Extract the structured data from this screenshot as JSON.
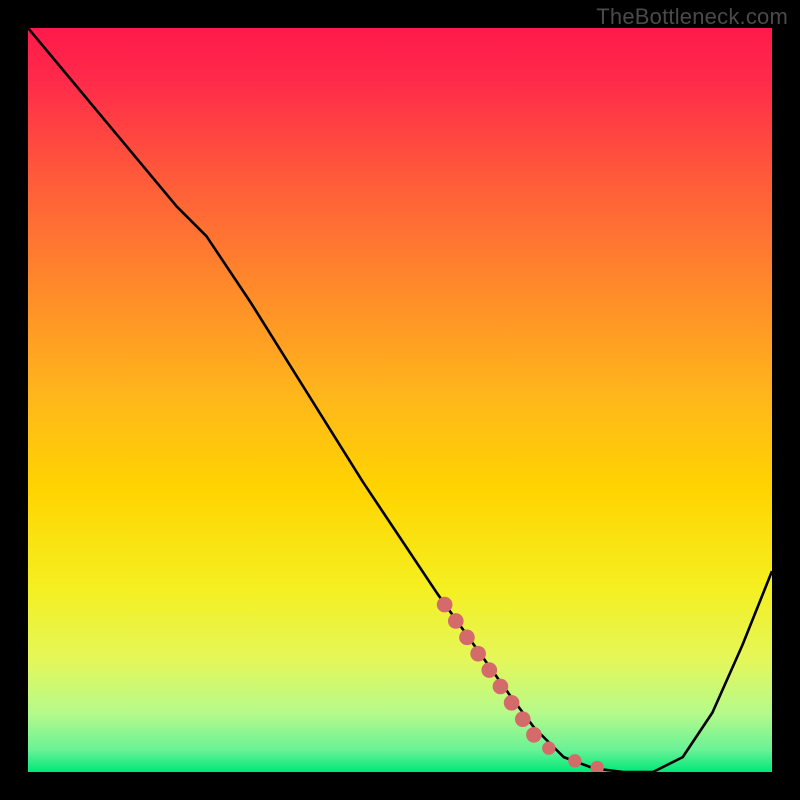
{
  "watermark": "TheBottleneck.com",
  "colors": {
    "frame": "#000000",
    "gradient_top": "#ff1a4b",
    "gradient_mid": "#ffd400",
    "gradient_bottom": "#00e878",
    "curve": "#000000",
    "marker": "#d46a6a"
  },
  "chart_data": {
    "type": "line",
    "title": "",
    "xlabel": "",
    "ylabel": "",
    "xlim": [
      0,
      100
    ],
    "ylim": [
      0,
      100
    ],
    "x": [
      0,
      5,
      10,
      15,
      20,
      24,
      30,
      35,
      40,
      45,
      50,
      55,
      60,
      65,
      68,
      72,
      76,
      80,
      84,
      88,
      92,
      96,
      100
    ],
    "y": [
      100,
      94,
      88,
      82,
      76,
      72,
      63,
      55,
      47,
      39,
      31.5,
      24,
      17,
      10,
      6,
      2,
      0.5,
      0,
      0,
      2,
      8,
      17,
      27
    ],
    "highlight_segment": {
      "x": [
        56,
        57.5,
        59,
        60.5,
        62,
        63.5,
        65,
        66.5,
        68
      ],
      "y": [
        22.5,
        20.3,
        18.1,
        15.9,
        13.7,
        11.5,
        9.3,
        7.1,
        5.0
      ]
    },
    "highlight_dots": {
      "x": [
        70,
        73.5,
        76.5
      ],
      "y": [
        3.2,
        1.5,
        0.6
      ]
    }
  }
}
